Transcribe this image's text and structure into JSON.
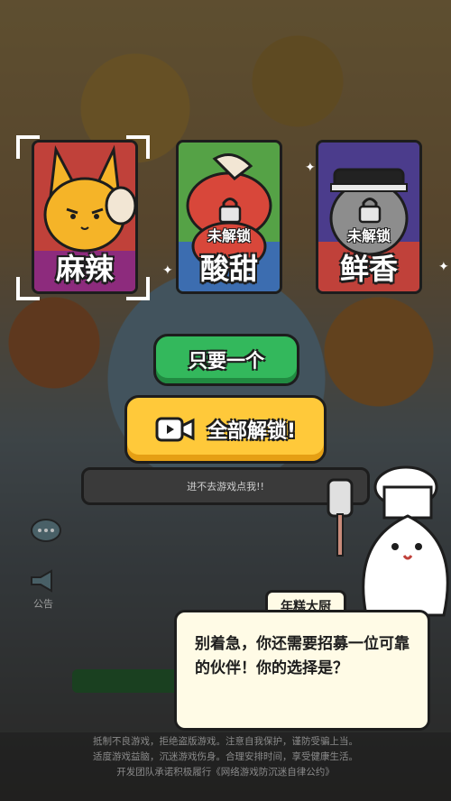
{
  "characters": [
    {
      "name": "麻辣",
      "locked": false,
      "selected": true,
      "art_color": "#f5b428",
      "bg_color": "#c0413a"
    },
    {
      "name": "酸甜",
      "locked": true,
      "lock_label": "未解锁",
      "art_color": "#d8473a",
      "bg_color": "#55a246"
    },
    {
      "name": "鲜香",
      "locked": true,
      "lock_label": "未解锁",
      "art_color": "#8d8d8d",
      "bg_color": "#4b3c8c"
    }
  ],
  "buttons": {
    "only_one": "只要一个",
    "unlock_all": "全部解锁!"
  },
  "hint": "进不去游戏点我!!",
  "dialog": {
    "speaker": "年糕大厨",
    "text": "别着急，你还需要招募一位可靠的伙伴！你的选择是？"
  },
  "colors": {
    "green_button": "#33b85c",
    "yellow_button": "#ffc93a",
    "dialog_bg": "#fffbe6",
    "outline": "#1d1d1d"
  },
  "footer": {
    "line1": "抵制不良游戏，拒绝盗版游戏。注意自我保护，谨防受骗上当。",
    "line2": "适度游戏益脑，沉迷游戏伤身。合理安排时间，享受健康生活。",
    "line3": "开发团队承诺积极履行《网络游戏防沉迷自律公约》"
  },
  "side": {
    "notice_label": "公告"
  }
}
